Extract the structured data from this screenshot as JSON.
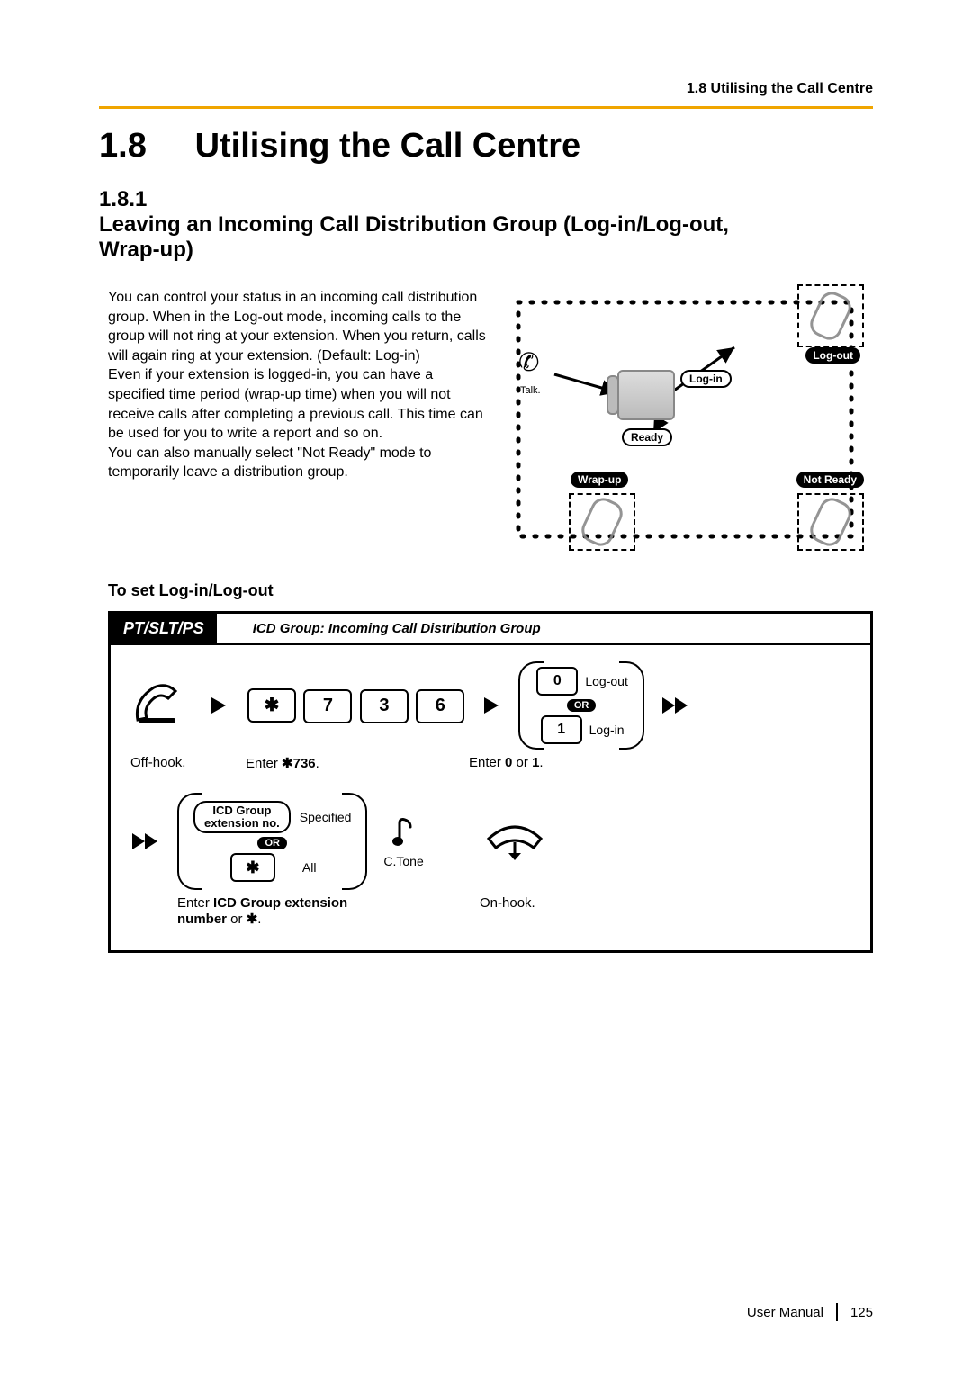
{
  "header": {
    "running": "1.8 Utilising the Call Centre"
  },
  "section": {
    "number": "1.8",
    "title": "Utilising the Call Centre"
  },
  "subsection": {
    "number": "1.8.1",
    "title": "Leaving an Incoming Call Distribution Group (Log-in/Log-out, Wrap-up)"
  },
  "intro": {
    "p1": "You can control your status in an incoming call distribution group. When in the Log-out mode, incoming calls to the group will not ring at your extension. When you return, calls will again ring at your extension. (Default: Log-in)",
    "p2": "Even if your extension is logged-in, you can have a specified time period (wrap-up time) when you will not receive calls after completing a previous call. This time can be used for you to write a report and so on.",
    "p3": "You can also manually select \"Not Ready\" mode to temporarily leave a distribution group."
  },
  "stateDiagram": {
    "talk": "Talk.",
    "login": "Log-in",
    "logout": "Log-out",
    "ready": "Ready",
    "wrapup": "Wrap-up",
    "notready": "Not Ready"
  },
  "procedure": {
    "heading": "To set Log-in/Log-out",
    "deviceTag": "PT/SLT/PS",
    "headerNote": "ICD Group: Incoming Call Distribution Group",
    "row1": {
      "offhookCaption": "Off-hook.",
      "keys": {
        "star": "✱",
        "d1": "7",
        "d2": "3",
        "d3": "6"
      },
      "enterCodeCaption_a": "Enter ",
      "enterCodeCaption_b": "✱736",
      "enterCodeCaption_c": ".",
      "opt0": "0",
      "opt0label": "Log-out",
      "opt1": "1",
      "opt1label": "Log-in",
      "or": "OR",
      "enter01_a": "Enter ",
      "enter01_b": "0",
      "enter01_c": " or ",
      "enter01_d": "1",
      "enter01_e": "."
    },
    "row2": {
      "icdBox_l1": "ICD Group",
      "icdBox_l2": "extension no.",
      "specified": "Specified",
      "all": "All",
      "or": "OR",
      "star": "✱",
      "ctone": "C.Tone",
      "enterExt_a": "Enter ",
      "enterExt_b": "ICD Group extension number",
      "enterExt_c": " or ",
      "enterExt_d": "✱",
      "enterExt_e": ".",
      "onhookCaption": "On-hook."
    }
  },
  "footer": {
    "doc": "User Manual",
    "page": "125"
  },
  "colors": {
    "accent": "#f0a500"
  }
}
